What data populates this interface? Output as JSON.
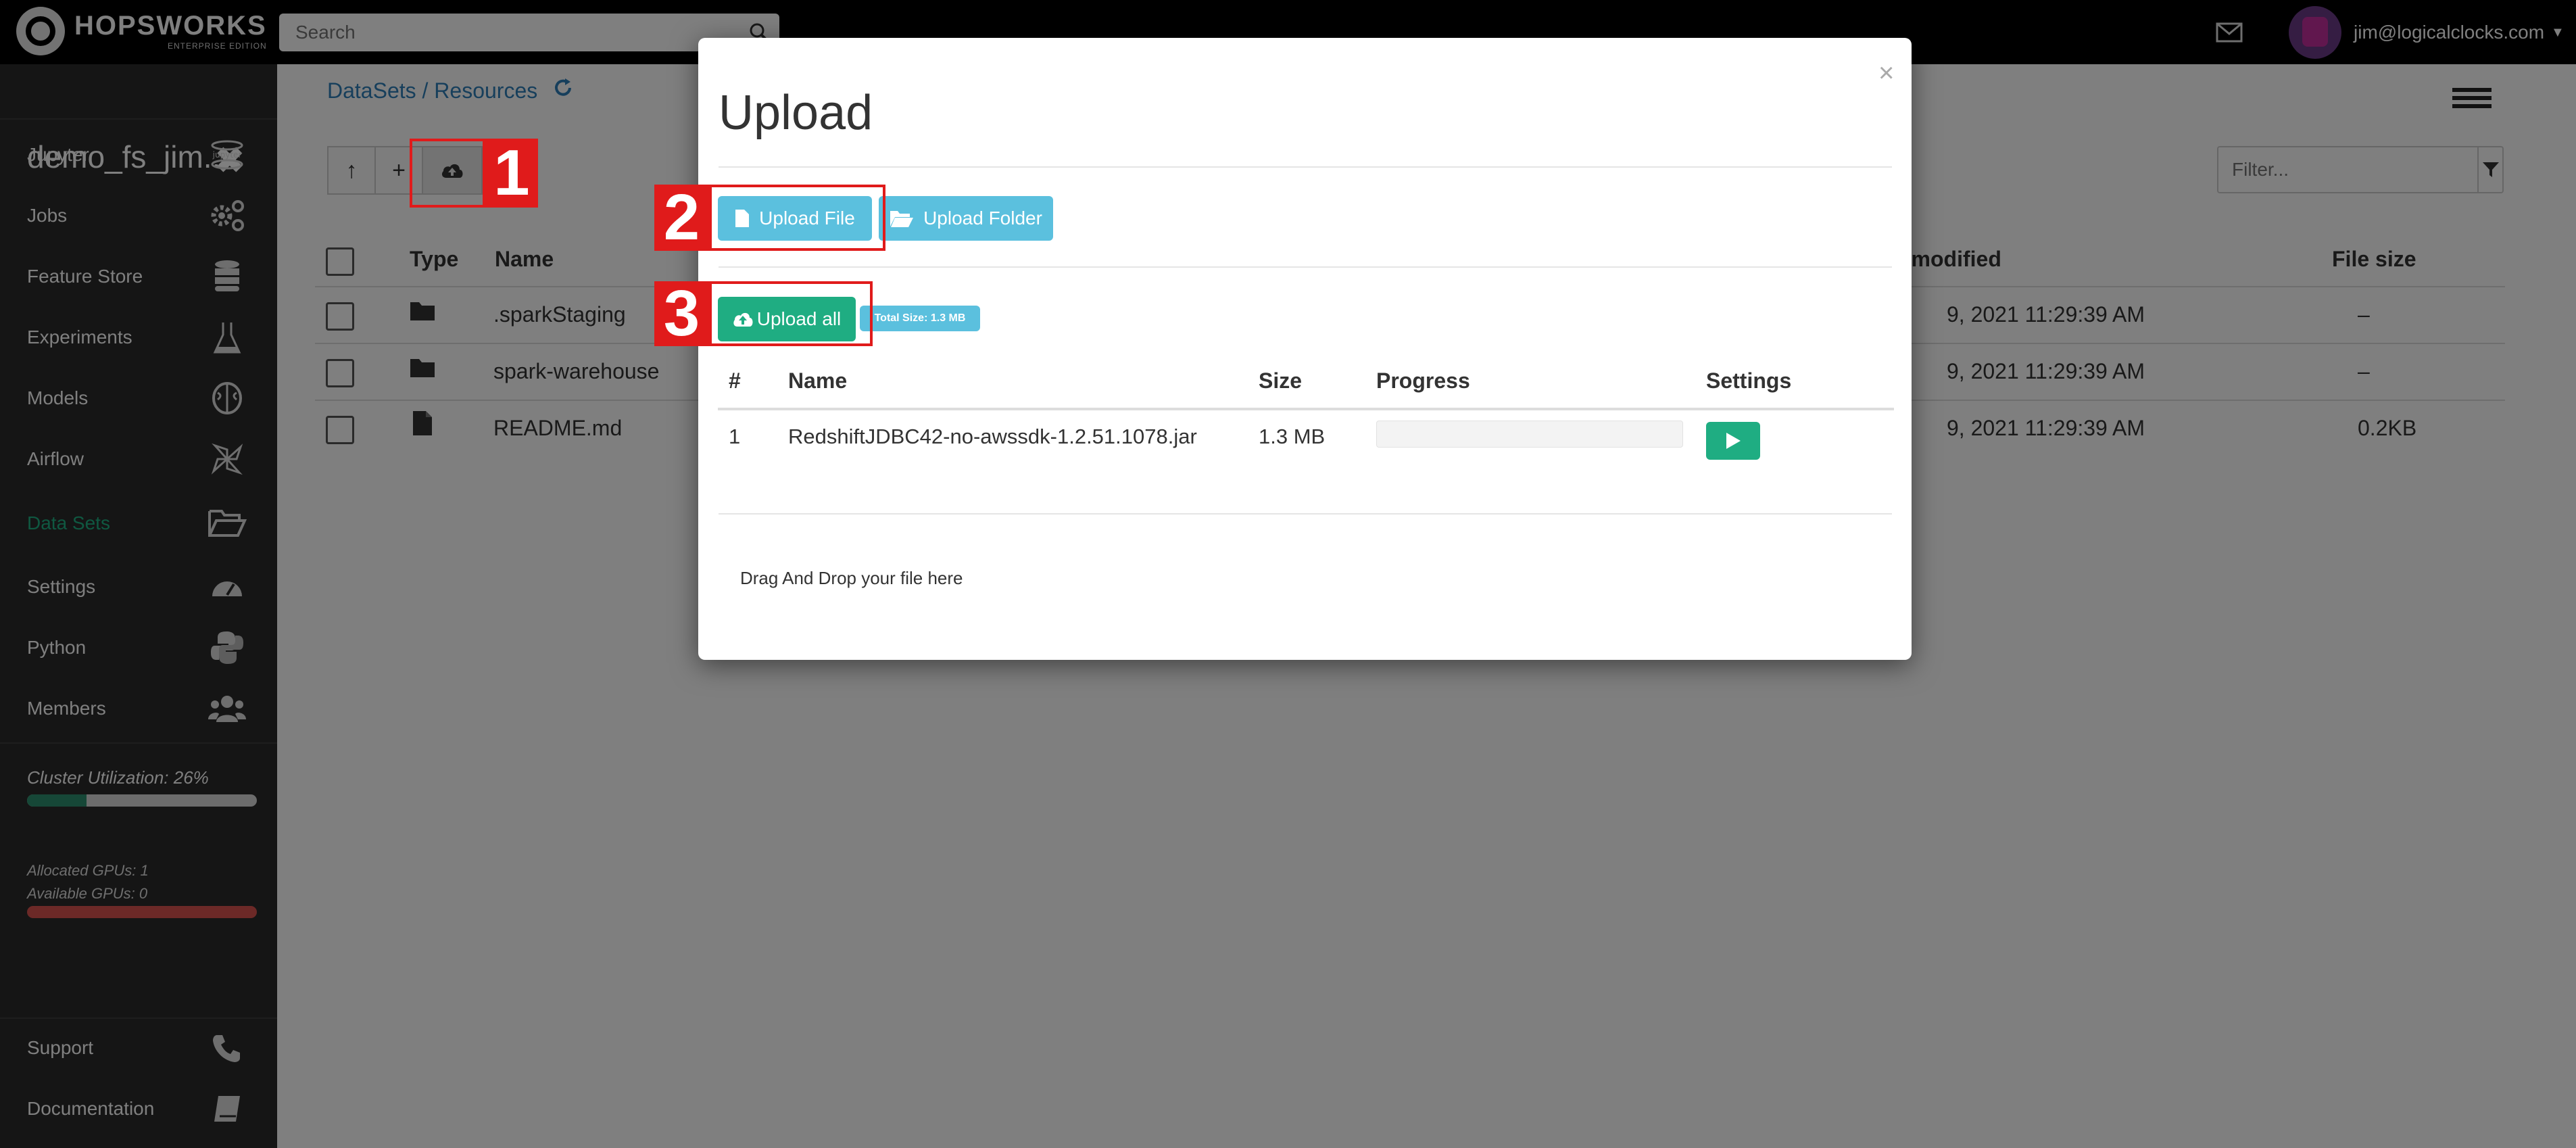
{
  "topbar": {
    "brand": "HOPSWORKS",
    "edition": "ENTERPRISE EDITION",
    "search_placeholder": "Search",
    "user_email": "jim@logicalclocks.com",
    "icons": [
      "search-icon",
      "mail-icon",
      "chevron-down-icon"
    ]
  },
  "sidebar": {
    "project_name": "demo_fs_jim...",
    "items": [
      {
        "label": "Jupyter",
        "icon": "jupyter-icon"
      },
      {
        "label": "Jobs",
        "icon": "gears-icon"
      },
      {
        "label": "Feature Store",
        "icon": "database-icon"
      },
      {
        "label": "Experiments",
        "icon": "flask-icon"
      },
      {
        "label": "Models",
        "icon": "brain-icon"
      },
      {
        "label": "Airflow",
        "icon": "pinwheel-icon"
      },
      {
        "label": "Data Sets",
        "icon": "folder-open-icon",
        "active": true
      },
      {
        "label": "Settings",
        "icon": "dashboard-icon"
      },
      {
        "label": "Python",
        "icon": "python-icon"
      },
      {
        "label": "Members",
        "icon": "users-icon"
      }
    ],
    "cluster_utilization": "Cluster Utilization: 26%",
    "cluster_utilization_value": 0.26,
    "gpus_allocated": "Allocated GPUs: 1",
    "gpus_available": "Available GPUs: 0",
    "gpu_bar_value": 1.0,
    "footer": [
      {
        "label": "Support",
        "icon": "phone-icon"
      },
      {
        "label": "Documentation",
        "icon": "book-icon"
      }
    ],
    "active_color": "#1fb082"
  },
  "main": {
    "breadcrumb": "DataSets / Resources",
    "filter_placeholder": "Filter...",
    "toolbar": [
      "up-arrow-icon",
      "plus-icon",
      "cloud-upload-icon"
    ],
    "columns": [
      "Type",
      "Name",
      "t modified",
      "File size"
    ],
    "rows": [
      {
        "type": "folder",
        "name": ".sparkStaging",
        "modified": "9, 2021 11:29:39 AM",
        "size": "–"
      },
      {
        "type": "folder",
        "name": "spark-warehouse",
        "modified": "9, 2021 11:29:39 AM",
        "size": "–"
      },
      {
        "type": "file",
        "name": "README.md",
        "modified": "9, 2021 11:29:39 AM",
        "size": "0.2KB"
      }
    ]
  },
  "modal": {
    "title": "Upload",
    "close": "×",
    "upload_file": "Upload File",
    "upload_folder": "Upload Folder",
    "upload_all": "Upload all",
    "total_size": "Total Size: 1.3 MB",
    "table_headers": [
      "#",
      "Name",
      "Size",
      "Progress",
      "Settings"
    ],
    "files": [
      {
        "index": "1",
        "name": "RedshiftJDBC42-no-awssdk-1.2.51.1078.jar",
        "size": "1.3 MB",
        "progress": 0.0
      }
    ],
    "drop_hint": "Drag And Drop your file here",
    "colors": {
      "info": "#5bc0de",
      "success": "#1fad82"
    }
  },
  "annotations": [
    "1",
    "2",
    "3"
  ],
  "annotation_color": "#e01b1b"
}
